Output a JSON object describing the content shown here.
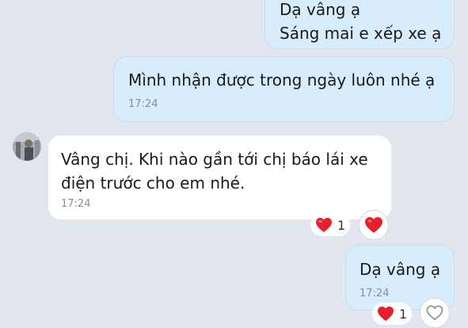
{
  "messages": [
    {
      "lines": [
        "Dạ vâng ạ",
        "Sáng mai e xếp xe ạ"
      ]
    },
    {
      "lines": [
        "Mình nhận được trong ngày luôn nhé ạ"
      ],
      "time": "17:24"
    },
    {
      "lines": [
        "Vâng chị. Khi nào gần tới chị báo lái xe",
        "điện trước cho em nhé."
      ],
      "time": "17:24",
      "reaction_count": "1"
    },
    {
      "lines": [
        "Dạ vâng ạ"
      ],
      "time": "17:24",
      "reaction_count": "1"
    }
  ],
  "icons": {
    "reaction": "heart-icon",
    "add_reaction": "heart-outline-icon",
    "avatar": "contact-avatar"
  },
  "colors": {
    "background": "#e2e7ef",
    "sent_bubble": "#d7ecfc",
    "received_bubble": "#ffffff",
    "heart": "#e8202e"
  }
}
